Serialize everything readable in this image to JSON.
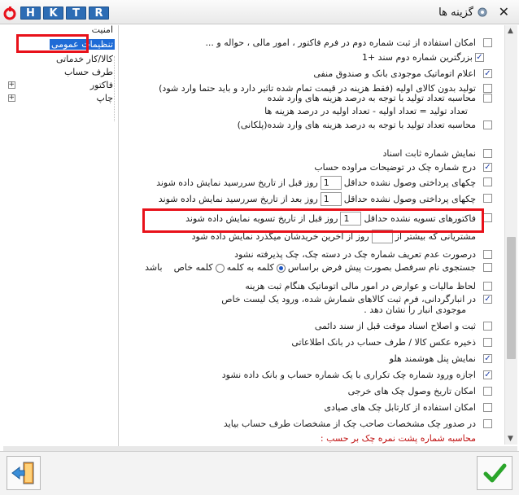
{
  "window": {
    "title": "گزینه ها",
    "close_glyph": "✕",
    "toolbar_buttons": [
      "H",
      "K",
      "T",
      "R"
    ]
  },
  "tree": {
    "items": [
      {
        "label": "امنیت",
        "expander": ""
      },
      {
        "label": "تنظیمات عمومی",
        "expander": "",
        "selected": true
      },
      {
        "label": "کالا/کار خدماتی",
        "expander": ""
      },
      {
        "label": "طرف حساب",
        "expander": ""
      },
      {
        "label": "فاکتور",
        "expander": "+"
      },
      {
        "label": "چاپ",
        "expander": "+"
      }
    ]
  },
  "options": {
    "o1": {
      "label": "امکان استفاده از ثبت شماره دوم در فرم فاکتور ، امور مالی ، حواله و ...",
      "checked": false
    },
    "o2": {
      "label": "بزرگترین شماره دوم سند +1",
      "checked": true
    },
    "o3": {
      "label": "اعلام اتوماتیک موجودی بانک و صندوق منفی",
      "checked": true
    },
    "o4": {
      "label": "تولید بدون کالای اولیه (فقط هزینه در قیمت تمام شده تاثیر دارد و باید حتما وارد شود)",
      "checked": false
    },
    "o5": {
      "label": "محاسبه تعداد تولید با توجه به درصد هزینه های وارد شده",
      "checked": false
    },
    "o5b": {
      "label": "تعداد تولید = تعداد اولیه - تعداد اولیه در درصد هزینه ها"
    },
    "o6": {
      "label": "محاسبه تعداد تولید با توجه به درصد هزینه های وارد شده(پلکانی)",
      "checked": false
    },
    "o7": {
      "label": "نمایش شماره ثابت اسناد",
      "checked": false
    },
    "o8": {
      "label": "درج شماره چک در توضیحات مراوده حساب",
      "checked": true
    },
    "o9": {
      "label_before": "چکهای پرداختی وصول نشده حداقل",
      "value": "1",
      "label_after": "روز قبل از تاریخ سررسید نمایش داده شوند",
      "checked": false
    },
    "o10": {
      "label_before": "چکهای پرداختی وصول نشده حداقل",
      "value": "1",
      "label_after": "روز بعد از تاریخ سررسید نمایش داده شوند",
      "checked": false
    },
    "o11": {
      "label_before": "فاکتورهای تسویه نشده حداقل",
      "value": "1",
      "label_after": "روز قبل از تاریخ تسویه نمایش داده شوند",
      "checked": false
    },
    "o12": {
      "label_before": "مشتریانی که بیشتر از",
      "value": "",
      "label_after": "روز از آخرین خریدشان میگذرد نمایش داده شود"
    },
    "o13": {
      "label": "درصورت عدم تعریف شماره چک در دسته چک، چک پذیرفته نشود",
      "checked": false
    },
    "o14": {
      "label": "جستجوی نام سرفصل بصورت پیش فرض براساس",
      "checked": false,
      "radio1": "کلمه به کلمه",
      "radio2": "کلمه خاص",
      "tail": "باشد"
    },
    "o15": {
      "label": "لحاظ مالیات و عوارض در امور مالی اتوماتیک هنگام ثبت هزینه",
      "checked": false
    },
    "o16": {
      "line1": "در انبارگردانی، فرم ثبت کالاهای شمارش شده، ورود یک لیست خاص",
      "line2": "موجودی انبار را نشان دهد .",
      "checked": true
    },
    "o17": {
      "label": "ثبت و اصلاح اسناد موقت قبل از سند دائمی",
      "checked": false
    },
    "o18": {
      "label": "ذخیره عکس کالا / طرف حساب در بانک اطلاعاتی",
      "checked": false
    },
    "o19": {
      "label": "نمایش پنل هوشمند هلو",
      "checked": true
    },
    "o20": {
      "label": "اجازه ورود شماره چک تکراری با یک شماره حساب و بانک داده نشود",
      "checked": true
    },
    "o21": {
      "label": "امکان تاریخ وصول چک های خرجی",
      "checked": false
    },
    "o22": {
      "label": "امکان استفاده از کارتابل چک های صیادی",
      "checked": false
    },
    "o23": {
      "label": "در صدور چک مشخصات صاحب چک از مشخصات طرف حساب بیاید",
      "checked": false
    },
    "o24": {
      "label": "محاسبه شماره پشت نمره چک بر حسب :"
    }
  },
  "colors": {
    "accent": "#2d6db5",
    "highlight": "#e8111a",
    "selected": "#1e6bd6",
    "ok": "#2aa52a"
  }
}
